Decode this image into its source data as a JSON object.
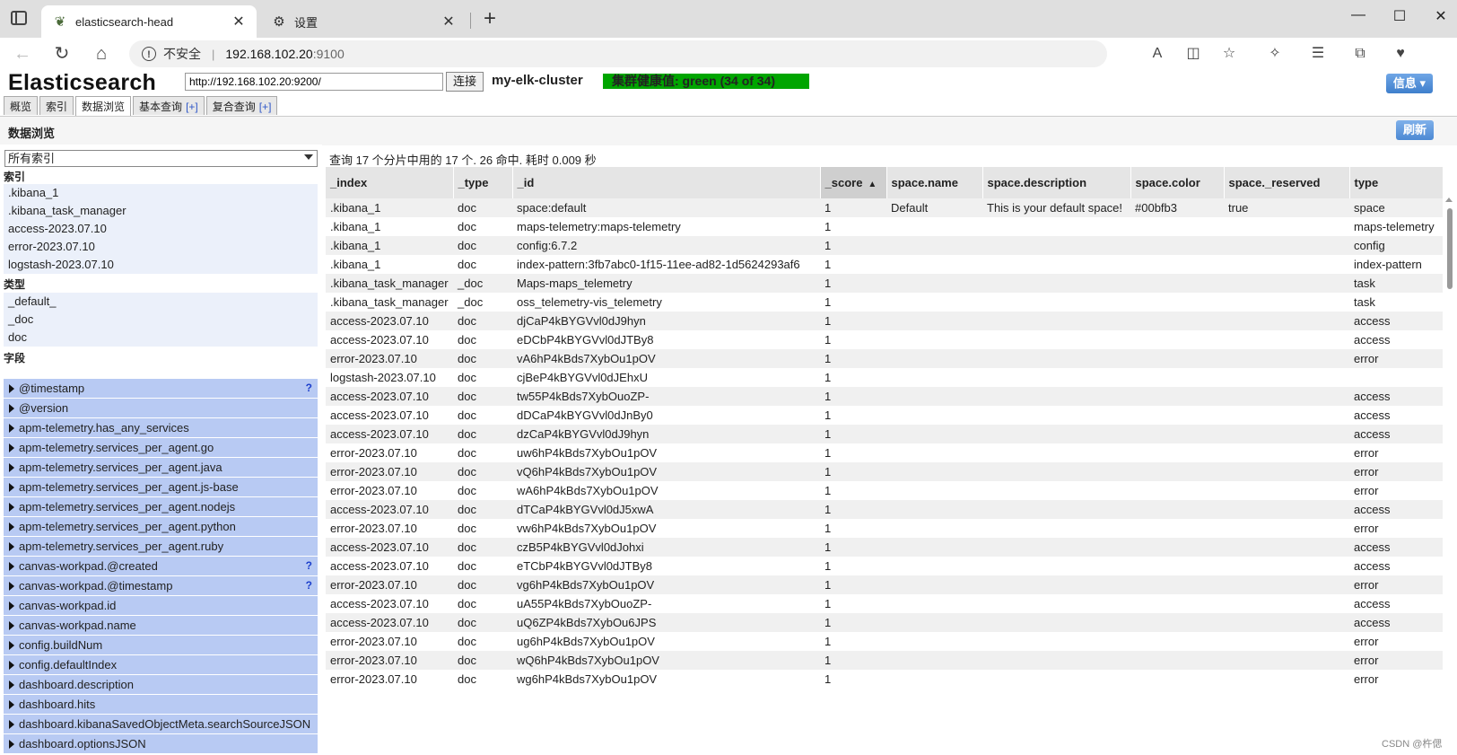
{
  "browser": {
    "tabs": [
      {
        "title": "elasticsearch-head",
        "active": true,
        "icon": "leaf-favicon-icon"
      },
      {
        "title": "设置",
        "active": false,
        "icon": "gear-icon"
      }
    ],
    "address": {
      "insecure_label": "不安全",
      "host": "192.168.102.20",
      "port": ":9100"
    }
  },
  "app": {
    "title": "Elasticsearch",
    "connection_url": "http://192.168.102.20:9200/",
    "connect_label": "连接",
    "cluster_name": "my-elk-cluster",
    "health_text": "集群健康值: green (34 of 34)",
    "health_color": "#00a500",
    "info_label": "信息 ▾",
    "tabs": [
      {
        "label": "概览"
      },
      {
        "label": "索引"
      },
      {
        "label": "数据浏览",
        "active": true
      },
      {
        "label": "基本查询",
        "plus": "[+]"
      },
      {
        "label": "复合查询",
        "plus": "[+]"
      }
    ]
  },
  "panel": {
    "title": "数据浏览",
    "refresh_label": "刷新"
  },
  "sidebar": {
    "index_select": "所有索引",
    "indices_heading": "索引",
    "indices": [
      ".kibana_1",
      ".kibana_task_manager",
      "access-2023.07.10",
      "error-2023.07.10",
      "logstash-2023.07.10"
    ],
    "types_heading": "类型",
    "types": [
      "_default_",
      "_doc",
      "doc"
    ],
    "fields_heading": "字段",
    "fields": [
      {
        "name": "@timestamp",
        "q": "?"
      },
      {
        "name": "@version",
        "q": ""
      },
      {
        "name": "apm-telemetry.has_any_services",
        "q": ""
      },
      {
        "name": "apm-telemetry.services_per_agent.go",
        "q": ""
      },
      {
        "name": "apm-telemetry.services_per_agent.java",
        "q": ""
      },
      {
        "name": "apm-telemetry.services_per_agent.js-base",
        "q": ""
      },
      {
        "name": "apm-telemetry.services_per_agent.nodejs",
        "q": ""
      },
      {
        "name": "apm-telemetry.services_per_agent.python",
        "q": ""
      },
      {
        "name": "apm-telemetry.services_per_agent.ruby",
        "q": ""
      },
      {
        "name": "canvas-workpad.@created",
        "q": "?"
      },
      {
        "name": "canvas-workpad.@timestamp",
        "q": "?"
      },
      {
        "name": "canvas-workpad.id",
        "q": ""
      },
      {
        "name": "canvas-workpad.name",
        "q": ""
      },
      {
        "name": "config.buildNum",
        "q": ""
      },
      {
        "name": "config.defaultIndex",
        "q": ""
      },
      {
        "name": "dashboard.description",
        "q": ""
      },
      {
        "name": "dashboard.hits",
        "q": ""
      },
      {
        "name": "dashboard.kibanaSavedObjectMeta.searchSourceJSON",
        "q": ""
      },
      {
        "name": "dashboard.optionsJSON",
        "q": ""
      }
    ]
  },
  "results": {
    "summary": "查询 17 个分片中用的 17 个. 26 命中. 耗时 0.009 秒",
    "columns": [
      "_index",
      "_type",
      "_id",
      "_score",
      "space.name",
      "space.description",
      "space.color",
      "space._reserved",
      "type"
    ],
    "sort_arrow": "▲",
    "rows": [
      [
        ".kibana_1",
        "doc",
        "space:default",
        "1",
        "Default",
        "This is your default space!",
        "#00bfb3",
        "true",
        "space"
      ],
      [
        ".kibana_1",
        "doc",
        "maps-telemetry:maps-telemetry",
        "1",
        "",
        "",
        "",
        "",
        "maps-telemetry"
      ],
      [
        ".kibana_1",
        "doc",
        "config:6.7.2",
        "1",
        "",
        "",
        "",
        "",
        "config"
      ],
      [
        ".kibana_1",
        "doc",
        "index-pattern:3fb7abc0-1f15-11ee-ad82-1d5624293af6",
        "1",
        "",
        "",
        "",
        "",
        "index-pattern"
      ],
      [
        ".kibana_task_manager",
        "_doc",
        "Maps-maps_telemetry",
        "1",
        "",
        "",
        "",
        "",
        "task"
      ],
      [
        ".kibana_task_manager",
        "_doc",
        "oss_telemetry-vis_telemetry",
        "1",
        "",
        "",
        "",
        "",
        "task"
      ],
      [
        "access-2023.07.10",
        "doc",
        "djCaP4kBYGVvl0dJ9hyn",
        "1",
        "",
        "",
        "",
        "",
        "access"
      ],
      [
        "access-2023.07.10",
        "doc",
        "eDCbP4kBYGVvl0dJTBy8",
        "1",
        "",
        "",
        "",
        "",
        "access"
      ],
      [
        "error-2023.07.10",
        "doc",
        "vA6hP4kBds7XybOu1pOV",
        "1",
        "",
        "",
        "",
        "",
        "error"
      ],
      [
        "logstash-2023.07.10",
        "doc",
        "cjBeP4kBYGVvl0dJEhxU",
        "1",
        "",
        "",
        "",
        "",
        ""
      ],
      [
        "access-2023.07.10",
        "doc",
        "tw55P4kBds7XybOuoZP-",
        "1",
        "",
        "",
        "",
        "",
        "access"
      ],
      [
        "access-2023.07.10",
        "doc",
        "dDCaP4kBYGVvl0dJnBy0",
        "1",
        "",
        "",
        "",
        "",
        "access"
      ],
      [
        "access-2023.07.10",
        "doc",
        "dzCaP4kBYGVvl0dJ9hyn",
        "1",
        "",
        "",
        "",
        "",
        "access"
      ],
      [
        "error-2023.07.10",
        "doc",
        "uw6hP4kBds7XybOu1pOV",
        "1",
        "",
        "",
        "",
        "",
        "error"
      ],
      [
        "error-2023.07.10",
        "doc",
        "vQ6hP4kBds7XybOu1pOV",
        "1",
        "",
        "",
        "",
        "",
        "error"
      ],
      [
        "error-2023.07.10",
        "doc",
        "wA6hP4kBds7XybOu1pOV",
        "1",
        "",
        "",
        "",
        "",
        "error"
      ],
      [
        "access-2023.07.10",
        "doc",
        "dTCaP4kBYGVvl0dJ5xwA",
        "1",
        "",
        "",
        "",
        "",
        "access"
      ],
      [
        "error-2023.07.10",
        "doc",
        "vw6hP4kBds7XybOu1pOV",
        "1",
        "",
        "",
        "",
        "",
        "error"
      ],
      [
        "access-2023.07.10",
        "doc",
        "czB5P4kBYGVvl0dJohxi",
        "1",
        "",
        "",
        "",
        "",
        "access"
      ],
      [
        "access-2023.07.10",
        "doc",
        "eTCbP4kBYGVvl0dJTBy8",
        "1",
        "",
        "",
        "",
        "",
        "access"
      ],
      [
        "error-2023.07.10",
        "doc",
        "vg6hP4kBds7XybOu1pOV",
        "1",
        "",
        "",
        "",
        "",
        "error"
      ],
      [
        "access-2023.07.10",
        "doc",
        "uA55P4kBds7XybOuoZP-",
        "1",
        "",
        "",
        "",
        "",
        "access"
      ],
      [
        "access-2023.07.10",
        "doc",
        "uQ6ZP4kBds7XybOu6JPS",
        "1",
        "",
        "",
        "",
        "",
        "access"
      ],
      [
        "error-2023.07.10",
        "doc",
        "ug6hP4kBds7XybOu1pOV",
        "1",
        "",
        "",
        "",
        "",
        "error"
      ],
      [
        "error-2023.07.10",
        "doc",
        "wQ6hP4kBds7XybOu1pOV",
        "1",
        "",
        "",
        "",
        "",
        "error"
      ],
      [
        "error-2023.07.10",
        "doc",
        "wg6hP4kBds7XybOu1pOV",
        "1",
        "",
        "",
        "",
        "",
        "error"
      ]
    ]
  },
  "watermark": "CSDN @杵偲"
}
